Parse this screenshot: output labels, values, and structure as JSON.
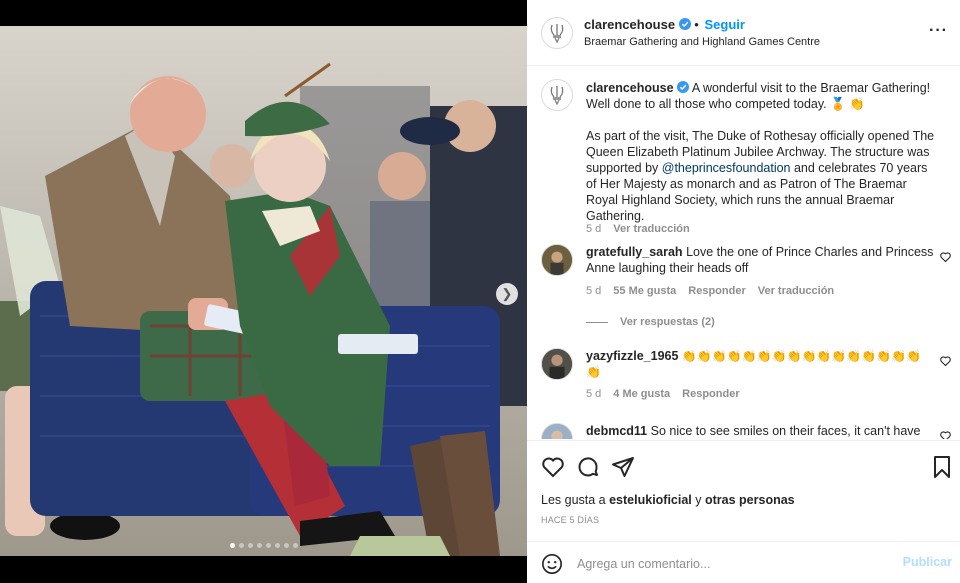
{
  "post": {
    "username": "clarencehouse",
    "follow_label": "Seguir",
    "location": "Braemar Gathering and Highland Games Centre",
    "more_icon": "more-options-icon",
    "caption_p1": "A wonderful visit to the Braemar Gathering! Well done to all those who competed today. 🏅 👏",
    "caption_p2_before": "As part of the visit, The Duke of Rothesay officially opened The Queen Elizabeth Platinum Jubilee Archway. The structure was supported by ",
    "caption_mention": "@theprincesfoundation",
    "caption_p2_after": " and celebrates 70 years of Her Majesty as monarch and as Patron of The Braemar Royal Highland Society, which runs the annual Braemar Gathering.",
    "caption_time": "5 d",
    "caption_translate": "Ver traducción"
  },
  "comments": [
    {
      "username": "gratefully_sarah",
      "text": "Love the one of Prince Charles and Princess Anne laughing their heads off",
      "time": "5 d",
      "likes": "55 Me gusta",
      "reply": "Responder",
      "translate": "Ver traducción",
      "view_replies": "Ver respuestas (2)"
    },
    {
      "username": "yazyfizzle_1965",
      "text": "👏👏👏👏👏👏👏👏👏👏👏👏👏👏👏👏👏",
      "time": "5 d",
      "likes": "4 Me gusta",
      "reply": "Responder"
    },
    {
      "username": "debmcd11",
      "text": "So nice to see smiles on their faces, it can't have"
    }
  ],
  "actions": {
    "likes_prefix": "Les gusta a ",
    "likes_user": "estelukioficial",
    "likes_middle": " y ",
    "likes_others": "otras personas",
    "date": "HACE 5 DÍAS"
  },
  "composer": {
    "placeholder": "Agrega un comentario...",
    "publish": "Publicar"
  },
  "carousel": {
    "dot_count": 8,
    "active_index": 0
  },
  "colors": {
    "accent": "#0095f6",
    "verified": "#3897f0",
    "publish_disabled": "#b2dffc"
  }
}
